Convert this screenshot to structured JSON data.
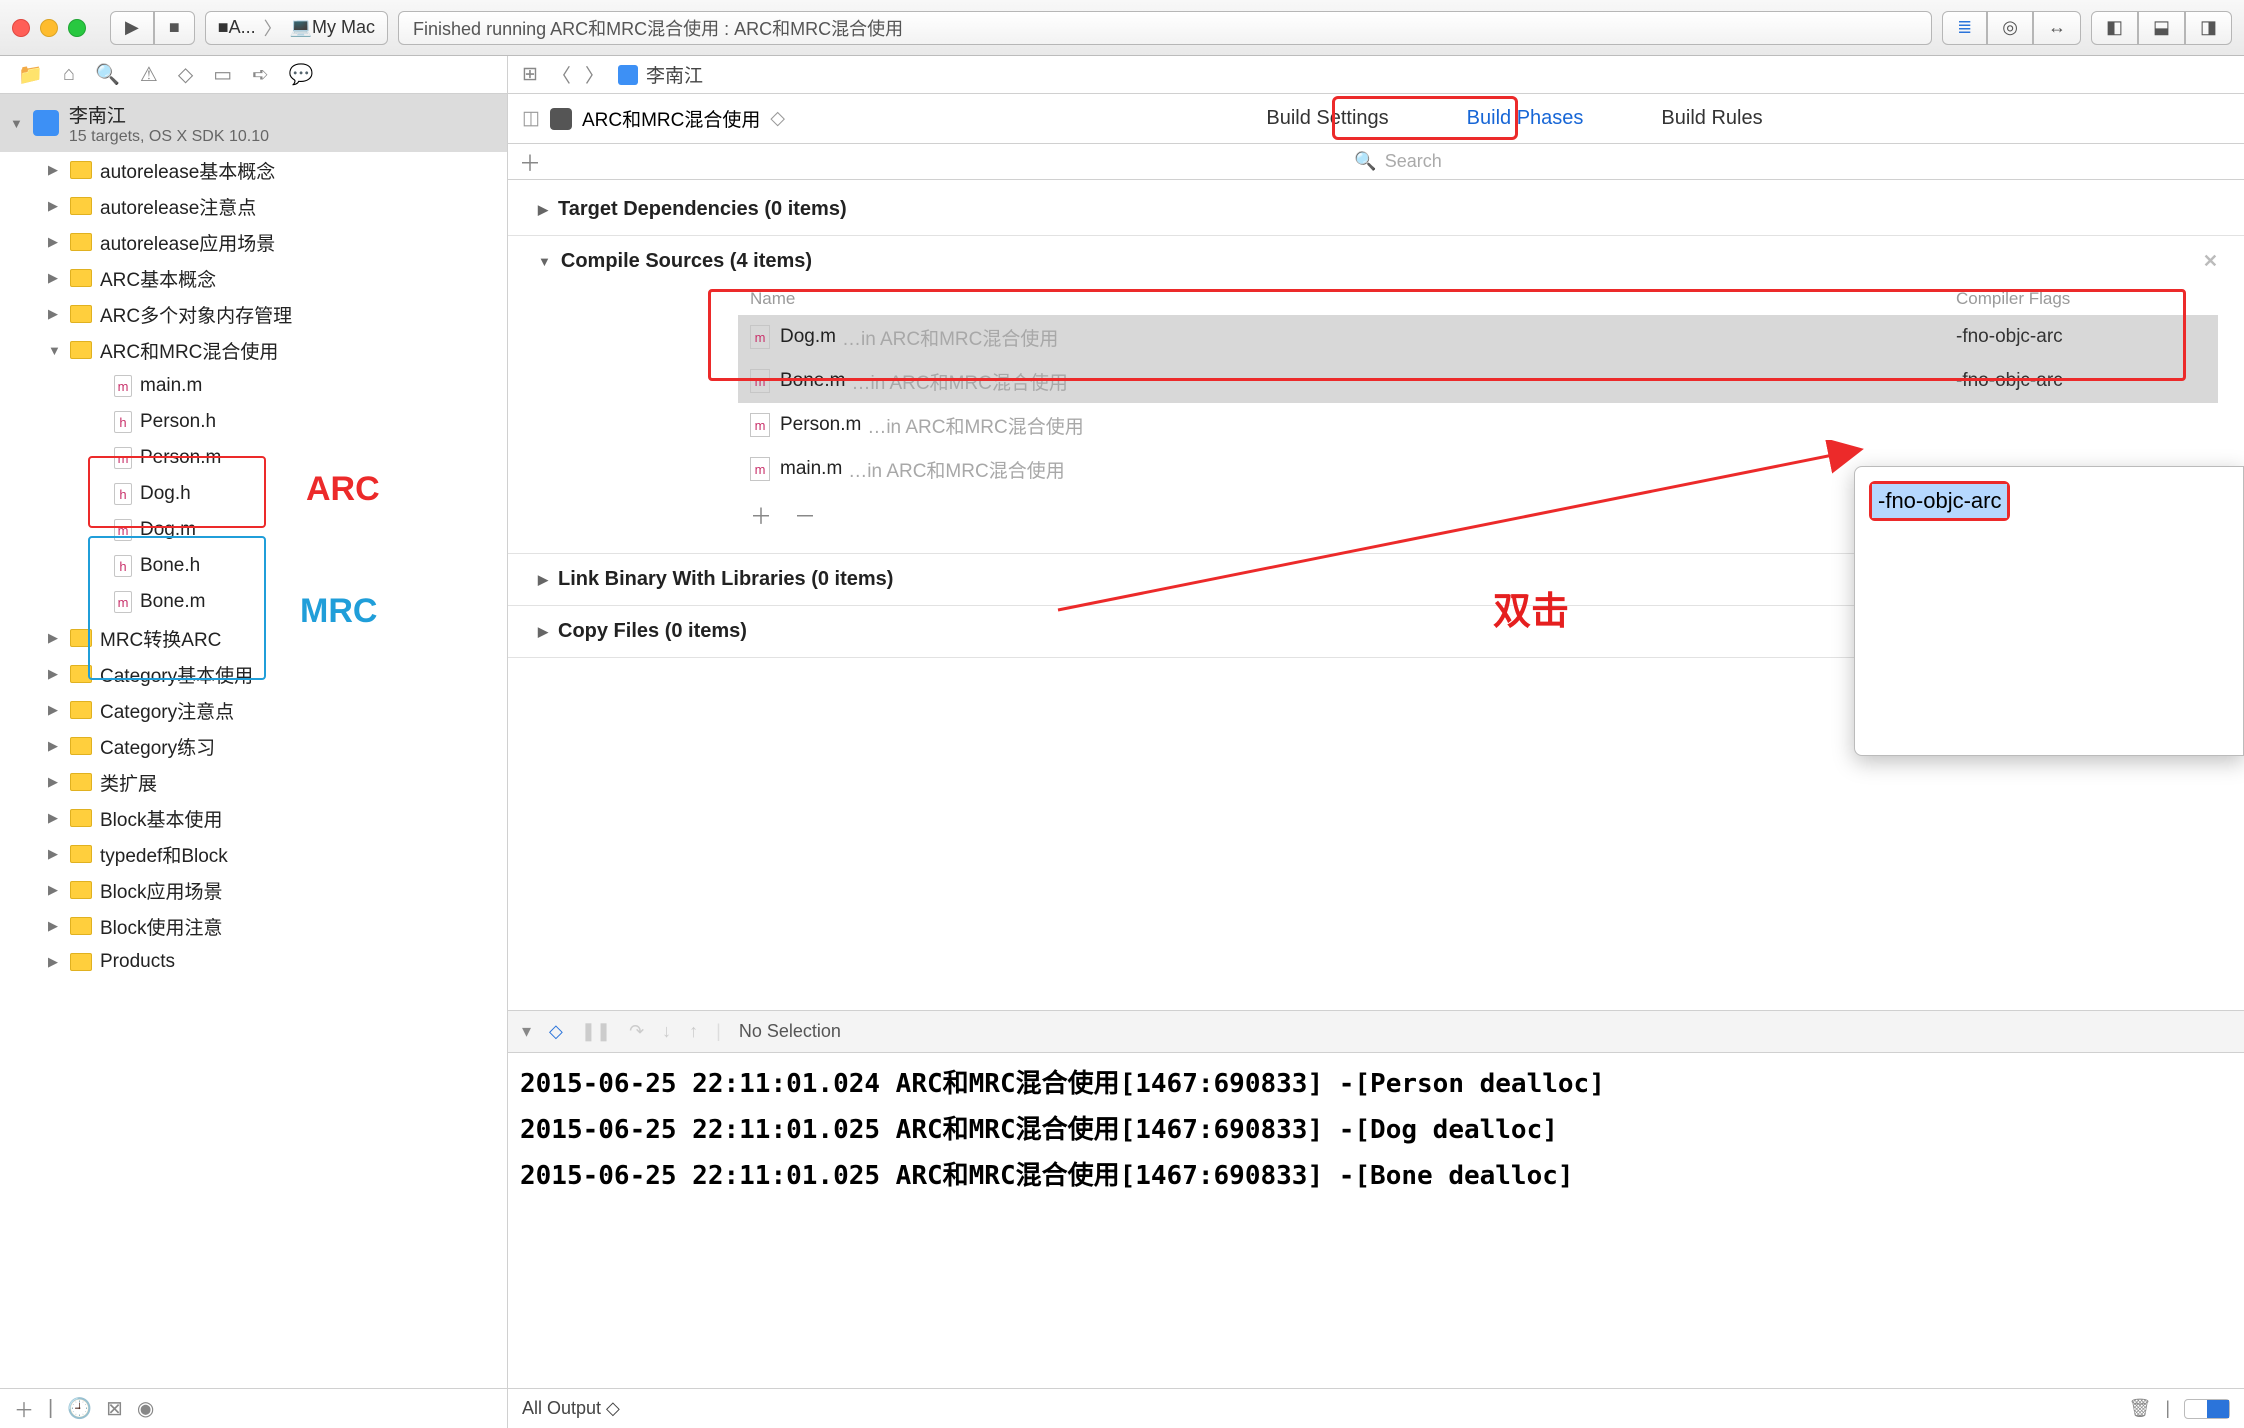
{
  "titlebar": {
    "scheme_app": "A...",
    "scheme_device": "My Mac",
    "status": "Finished running ARC和MRC混合使用 : ARC和MRC混合使用"
  },
  "project": {
    "name": "李南江",
    "subtitle": "15 targets, OS X SDK 10.10"
  },
  "tree": [
    {
      "type": "folder",
      "depth": 1,
      "expanded": false,
      "label": "autorelease基本概念"
    },
    {
      "type": "folder",
      "depth": 1,
      "expanded": false,
      "label": "autorelease注意点"
    },
    {
      "type": "folder",
      "depth": 1,
      "expanded": false,
      "label": "autorelease应用场景"
    },
    {
      "type": "folder",
      "depth": 1,
      "expanded": false,
      "label": "ARC基本概念"
    },
    {
      "type": "folder",
      "depth": 1,
      "expanded": false,
      "label": "ARC多个对象内存管理"
    },
    {
      "type": "folder",
      "depth": 1,
      "expanded": true,
      "label": "ARC和MRC混合使用"
    },
    {
      "type": "file",
      "depth": 2,
      "kind": "m",
      "label": "main.m"
    },
    {
      "type": "file",
      "depth": 2,
      "kind": "h",
      "label": "Person.h"
    },
    {
      "type": "file",
      "depth": 2,
      "kind": "m",
      "label": "Person.m"
    },
    {
      "type": "file",
      "depth": 2,
      "kind": "h",
      "label": "Dog.h"
    },
    {
      "type": "file",
      "depth": 2,
      "kind": "m",
      "label": "Dog.m"
    },
    {
      "type": "file",
      "depth": 2,
      "kind": "h",
      "label": "Bone.h"
    },
    {
      "type": "file",
      "depth": 2,
      "kind": "m",
      "label": "Bone.m"
    },
    {
      "type": "folder",
      "depth": 1,
      "expanded": false,
      "label": "MRC转换ARC"
    },
    {
      "type": "folder",
      "depth": 1,
      "expanded": false,
      "label": "Category基本使用"
    },
    {
      "type": "folder",
      "depth": 1,
      "expanded": false,
      "label": "Category注意点"
    },
    {
      "type": "folder",
      "depth": 1,
      "expanded": false,
      "label": "Category练习"
    },
    {
      "type": "folder",
      "depth": 1,
      "expanded": false,
      "label": "类扩展"
    },
    {
      "type": "folder",
      "depth": 1,
      "expanded": false,
      "label": "Block基本使用"
    },
    {
      "type": "folder",
      "depth": 1,
      "expanded": false,
      "label": "typedef和Block"
    },
    {
      "type": "folder",
      "depth": 1,
      "expanded": false,
      "label": "Block应用场景"
    },
    {
      "type": "folder",
      "depth": 1,
      "expanded": false,
      "label": "Block使用注意"
    },
    {
      "type": "folder",
      "depth": 1,
      "expanded": false,
      "label": "Products"
    }
  ],
  "annotations": {
    "arc_label": "ARC",
    "mrc_label": "MRC",
    "double_click_label": "双击"
  },
  "jumpbar": {
    "crumb": "李南江"
  },
  "target": {
    "name": "ARC和MRC混合使用",
    "tabs": {
      "settings": "Build Settings",
      "phases": "Build Phases",
      "rules": "Build Rules"
    }
  },
  "filter": {
    "placeholder": "Search"
  },
  "phases": {
    "deps": "Target Dependencies (0 items)",
    "compile": "Compile Sources (4 items)",
    "link": "Link Binary With Libraries (0 items)",
    "copy": "Copy Files (0 items)",
    "columns": {
      "name": "Name",
      "flags": "Compiler Flags"
    },
    "path_suffix": "…in ARC和MRC混合使用",
    "rows": [
      {
        "file": "Dog.m",
        "flag": "-fno-objc-arc",
        "sel": true
      },
      {
        "file": "Bone.m",
        "flag": "-fno-objc-arc",
        "sel": true
      },
      {
        "file": "Person.m",
        "flag": "",
        "sel": false
      },
      {
        "file": "main.m",
        "flag": "",
        "sel": false
      }
    ]
  },
  "popover": {
    "text": "-fno-objc-arc"
  },
  "debug": {
    "no_selection": "No Selection"
  },
  "console_lines": [
    "2015-06-25 22:11:01.024 ARC和MRC混合使用[1467:690833] -[Person dealloc]",
    "2015-06-25 22:11:01.025 ARC和MRC混合使用[1467:690833] -[Dog dealloc]",
    "2015-06-25 22:11:01.025 ARC和MRC混合使用[1467:690833] -[Bone dealloc]"
  ],
  "console_footer": {
    "filter": "All Output"
  }
}
